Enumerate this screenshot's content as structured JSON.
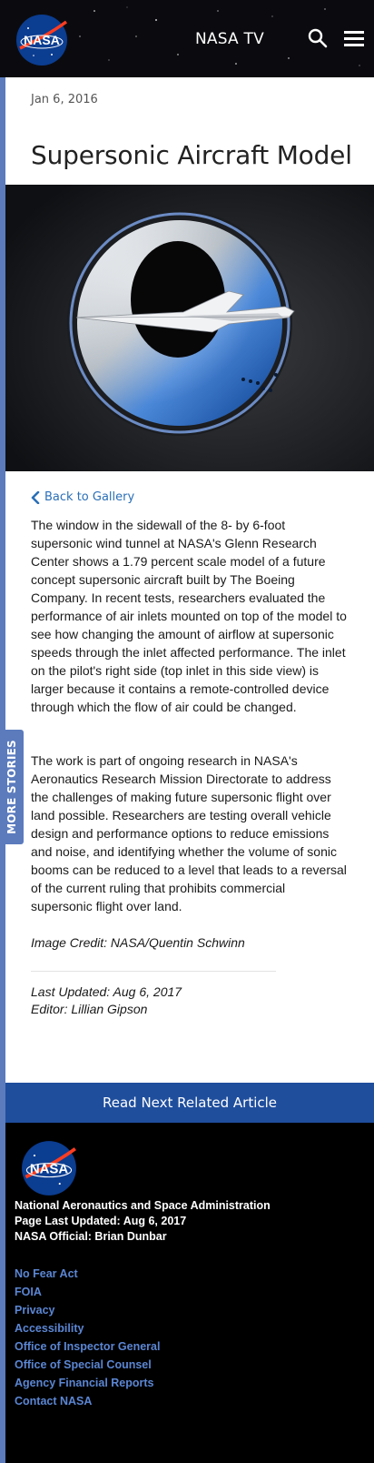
{
  "header": {
    "logo_text": "NASA",
    "nav_title": "NASA TV",
    "icons": [
      "search-icon",
      "menu-icon"
    ]
  },
  "sidebar_tab": {
    "label": "MORE STORIES"
  },
  "article": {
    "date": "Jan 6, 2016",
    "title": "Supersonic Aircraft Model",
    "back_link": "Back to Gallery",
    "paragraphs": [
      "The window in the sidewall of the 8- by 6-foot supersonic wind tunnel at NASA's Glenn Research Center shows a 1.79 percent scale model of a future concept supersonic aircraft built by The Boeing Company. In recent tests, researchers evaluated the performance of air inlets mounted on top of the model to see how changing the amount of airflow at supersonic speeds through the inlet affected performance. The inlet on the pilot's right side (top inlet in this side view) is larger because it contains a remote-controlled device through which the flow of air could be changed.",
      "The work is part of ongoing research in NASA's Aeronautics Research Mission Directorate to address the challenges of making future supersonic flight over land possible. Researchers are testing overall vehicle design and performance options to reduce emissions and noise, and identifying whether the volume of sonic booms can be reduced to a level that leads to a reversal of the current ruling that prohibits commercial supersonic flight over land."
    ],
    "credit": "Image Credit: NASA/Quentin Schwinn",
    "last_updated": "Last Updated: Aug 6, 2017",
    "editor": "Editor: Lillian Gipson"
  },
  "related": {
    "label": "Read Next Related Article"
  },
  "footer": {
    "agency": "National Aeronautics and Space Administration",
    "page_updated": "Page Last Updated: Aug 6, 2017",
    "official": "NASA Official: Brian Dunbar",
    "links": [
      "No Fear Act",
      "FOIA",
      "Privacy",
      "Accessibility",
      "Office of Inspector General",
      "Office of Special Counsel",
      "Agency Financial Reports",
      "Contact NASA"
    ]
  },
  "colors": {
    "rail": "#5b7bbd",
    "link": "#2a6fb7",
    "related_bar": "#1f4e9d",
    "footer_link": "#5b86d3"
  }
}
